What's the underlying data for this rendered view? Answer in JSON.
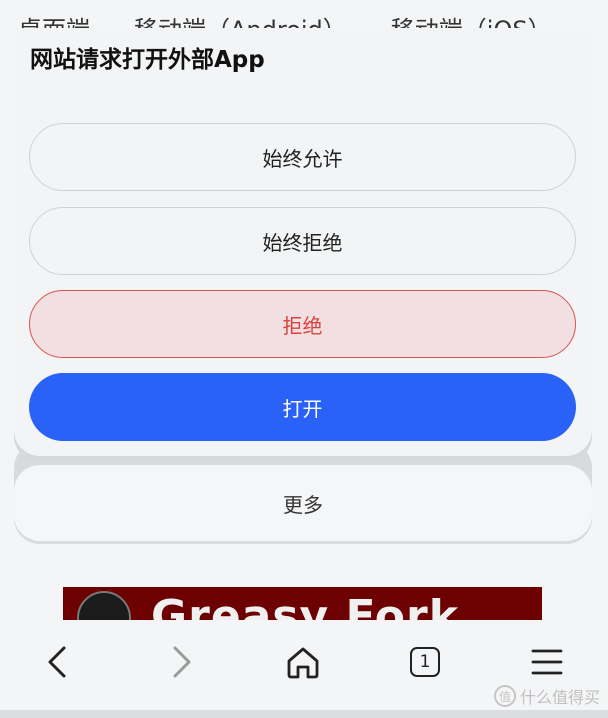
{
  "background_page": {
    "tabs": [
      "桌面端",
      "移动端（Android）",
      "移动端（iOS）"
    ],
    "banner_text": "Greasy Fork"
  },
  "dialog": {
    "title": "网站请求打开外部App",
    "buttons": {
      "always_allow": "始终允许",
      "always_deny": "始终拒绝",
      "deny": "拒绝",
      "open": "打开"
    },
    "more": "更多"
  },
  "toolbar": {
    "back_icon": "chevron-left-icon",
    "forward_icon": "chevron-right-icon",
    "home_icon": "home-icon",
    "tabs_count": "1",
    "menu_icon": "hamburger-icon"
  },
  "watermark": {
    "badge": "值",
    "text": "什么值得买"
  },
  "colors": {
    "open_button": "#2a62f8",
    "deny_text": "#d9433e",
    "deny_bg": "#f2dfe2",
    "banner_bg": "#6d0000"
  }
}
